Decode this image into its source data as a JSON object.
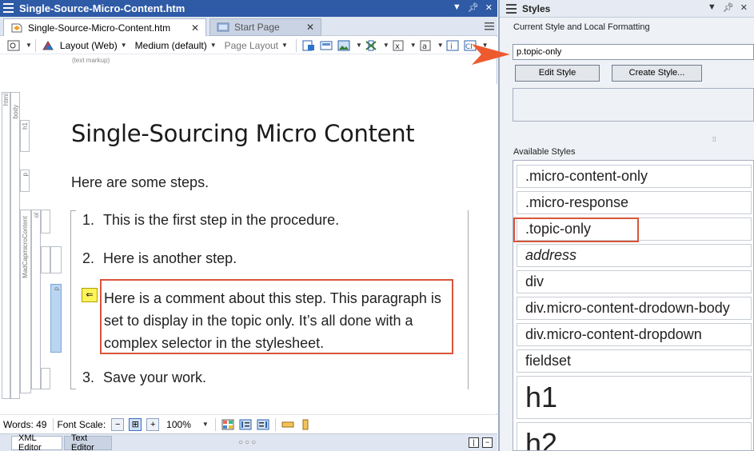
{
  "editor": {
    "window_title": "Single-Source-Micro-Content.htm",
    "tabs": [
      {
        "label": "Single-Source-Micro-Content.htm",
        "close": "✕"
      },
      {
        "label": "Start Page",
        "close": "✕"
      }
    ],
    "toolbar": {
      "layout": "Layout (Web)",
      "medium": "Medium (default)",
      "page_layout": "Page Layout"
    },
    "markup_note": "(text markup)",
    "structure_labels": {
      "html": "html",
      "body": "body",
      "h1": "h1",
      "p": "p",
      "div": "MadCapmicroContent",
      "ol": "ol",
      "li": "li",
      "p_selected": "p"
    },
    "content": {
      "heading": "Single-Sourcing Micro Content",
      "intro": "Here are some steps.",
      "steps": [
        {
          "num": "1.",
          "text": "This is the first step in the procedure."
        },
        {
          "num": "2.",
          "text": "Here is another step."
        },
        {
          "num": "3.",
          "text": "Save your work."
        }
      ],
      "comment_lines": [
        "Here is a comment about this step. This paragraph is",
        "set to display in the topic only. It’s all done with a",
        "complex selector in the stylesheet."
      ]
    },
    "status": {
      "words_label": "Words: 49",
      "font_scale_label": "Font Scale:",
      "zoom": "100%"
    },
    "bottom_tabs": [
      "XML Editor",
      "Text Editor"
    ]
  },
  "styles_pane": {
    "title": "Styles",
    "current_label": "Current Style and Local Formatting",
    "current_value": "p.topic-only",
    "edit_button": "Edit Style",
    "create_button": "Create Style...",
    "available_label": "Available Styles",
    "items": [
      ".micro-content-only",
      ".micro-response",
      ".topic-only",
      "address",
      "div",
      "div.micro-content-drodown-body",
      "div.micro-content-dropdown",
      "fieldset",
      "h1",
      "h2"
    ]
  },
  "colors": {
    "titlebar": "#2e5aa6",
    "highlight": "#d9553a",
    "arrow": "#ee5a2e"
  }
}
